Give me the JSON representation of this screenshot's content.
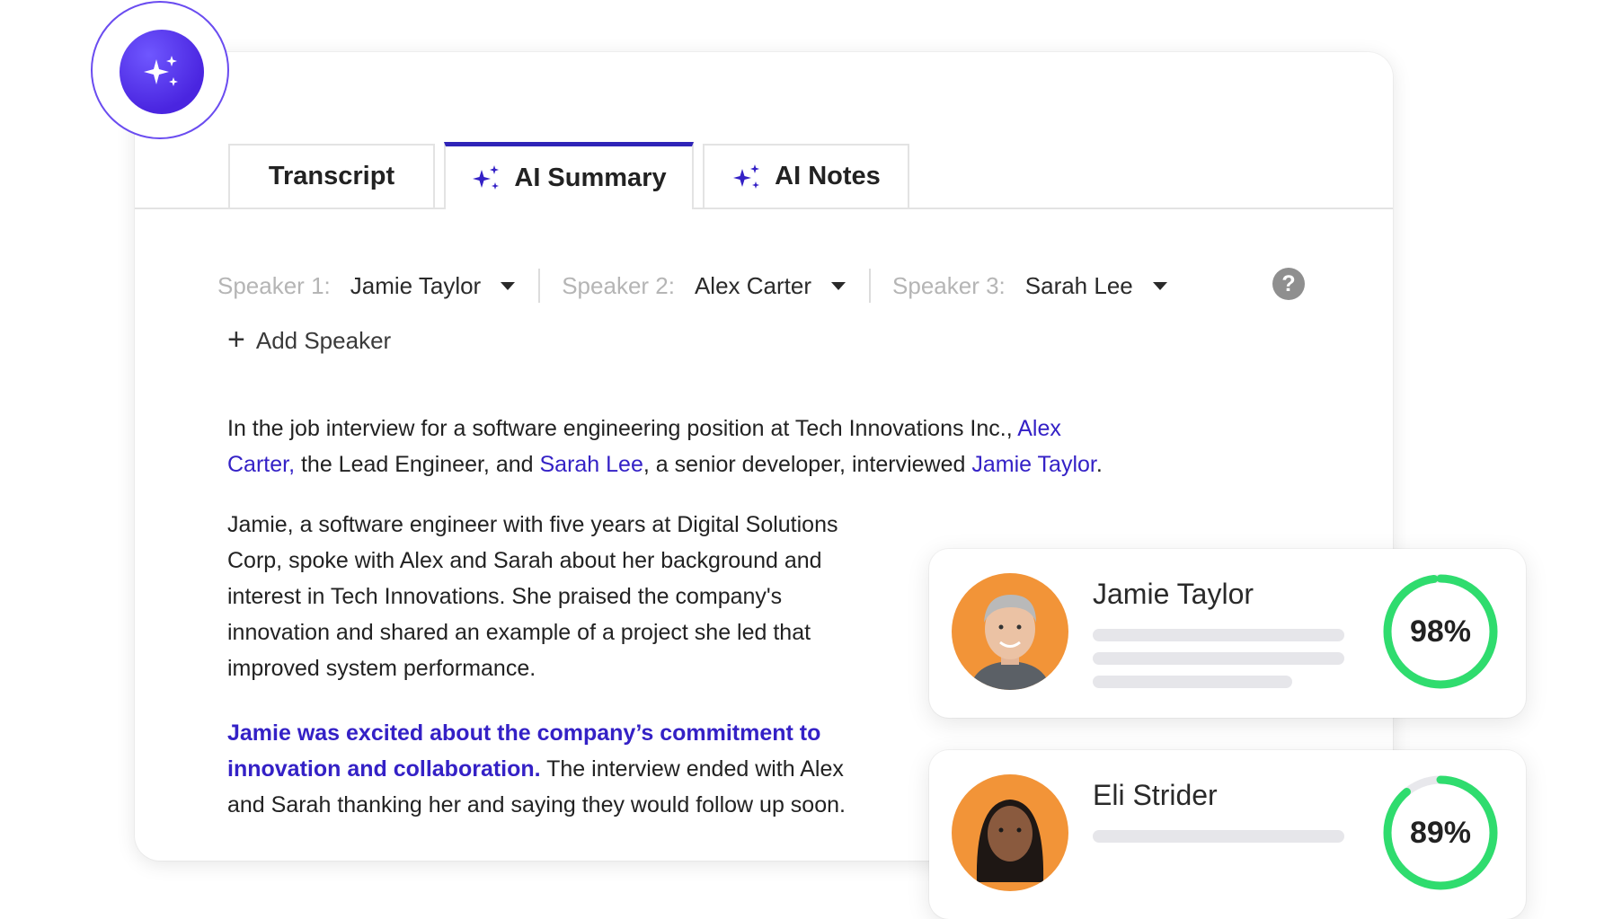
{
  "tabs": [
    {
      "label": "Transcript",
      "icon": "none"
    },
    {
      "label": "AI Summary",
      "icon": "sparkle-icon",
      "active": true
    },
    {
      "label": "AI Notes",
      "icon": "sparkle-icon"
    }
  ],
  "speakers": [
    {
      "label": "Speaker 1:",
      "name": "Jamie Taylor"
    },
    {
      "label": "Speaker 2:",
      "name": "Alex Carter"
    },
    {
      "label": "Speaker 3:",
      "name": "Sarah Lee"
    }
  ],
  "help": "?",
  "add_speaker": "Add Speaker",
  "summary": {
    "p1": {
      "t1": "In the job interview for a software engineering position at Tech Innovations Inc., ",
      "n1": "Alex",
      "n1b": "Carter,",
      "t2": " the Lead Engineer, and ",
      "n2": "Sarah Lee",
      "t3": ", a senior developer, interviewed ",
      "n3": "Jamie Taylor",
      "t4": "."
    },
    "p2": [
      "Jamie, a software engineer with five years at Digital Solutions",
      "Corp, spoke with Alex and Sarah about her background and",
      "interest in Tech Innovations. She praised the company's",
      "innovation and shared an example of a project she led that",
      "improved system performance."
    ],
    "p3": {
      "h1": "Jamie was excited about the company’s commitment to",
      "h2": "innovation and collaboration.",
      "t1": " The interview ended with Alex",
      "t2": "and Sarah thanking her and saying they would follow up soon."
    }
  },
  "candidates": [
    {
      "name": "Jamie Taylor",
      "score": "98%",
      "score_value": 0.98,
      "avatar": "avatar-photo"
    },
    {
      "name": "Eli Strider",
      "score": "89%",
      "score_value": 0.89,
      "avatar": "avatar-photo"
    }
  ],
  "colors": {
    "accent": "#3421c6",
    "badge": "#4a25e0",
    "score_ring": "#2fdc6e",
    "avatar_bg": "#f29438"
  }
}
